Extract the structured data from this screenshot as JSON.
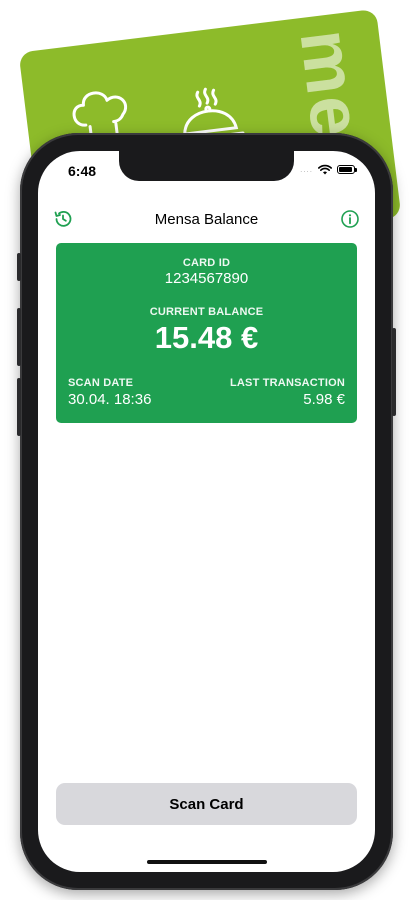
{
  "status_bar": {
    "time": "6:48",
    "signal_dots": "....",
    "wifi_icon": "wifi-icon",
    "battery_icon": "battery-icon"
  },
  "nav": {
    "title": "Mensa Balance",
    "left_icon": "history-icon",
    "right_icon": "info-icon"
  },
  "card": {
    "card_id_label": "CARD ID",
    "card_id": "1234567890",
    "balance_label": "CURRENT BALANCE",
    "balance": "15.48 €",
    "scan_date_label": "SCAN DATE",
    "scan_date": "30.04. 18:36",
    "last_tx_label": "LAST TRANSACTION",
    "last_tx": "5.98 €"
  },
  "actions": {
    "scan_label": "Scan Card"
  },
  "background_card": {
    "brand_text": "meal",
    "chef_icon": "chef-icon",
    "cloche_icon": "food-cloche-icon"
  },
  "colors": {
    "accent": "#1fa051",
    "mensa_card": "#8dbb2a",
    "button_bg": "#d8d8dc"
  }
}
